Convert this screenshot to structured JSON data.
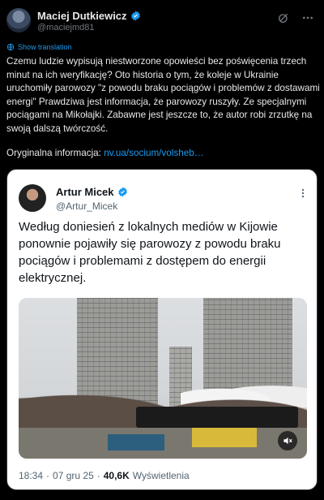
{
  "post": {
    "author_name": "Maciej Dutkiewicz",
    "author_handle": "@maciejmd81",
    "show_translation": "Show translation",
    "text": "Czemu ludzie wypisują niestworzone opowieści bez poświęcenia trzech minut na ich weryfikację? Oto historia o tym, że koleje w Ukrainie uruchomiły parowozy \"z powodu braku pociągów i problemów z dostawami energi\" Prawdziwa jest informacja, że parowozy ruszyły. Ze specjalnymi pociągami na Mikołajki. Zabawne jest jeszcze to, że autor robi zrzutkę na swoją dalszą twórczość.",
    "original_label": "Oryginalna informacja:",
    "original_link": "nv.ua/socium/volsheb…"
  },
  "quoted": {
    "author_name": "Artur Micek",
    "author_handle": "@Artur_Micek",
    "text": "Według doniesień z lokalnych mediów w Kijowie ponownie pojawiły się parowozy z powodu braku pociągów i problemami z dostępem do energii elektrycznej.",
    "time": "18:34",
    "sep1": "·",
    "date": "07 gru 25",
    "sep2": "·",
    "views_count": "40,6K",
    "views_label": "Wyświetlenia"
  },
  "icons": {
    "verified": "verified-badge-icon",
    "grok": "grok-icon",
    "more": "more-icon",
    "globe": "globe-icon",
    "mute": "mute-icon"
  },
  "colors": {
    "accent": "#1d9bf0",
    "background": "#000000"
  }
}
